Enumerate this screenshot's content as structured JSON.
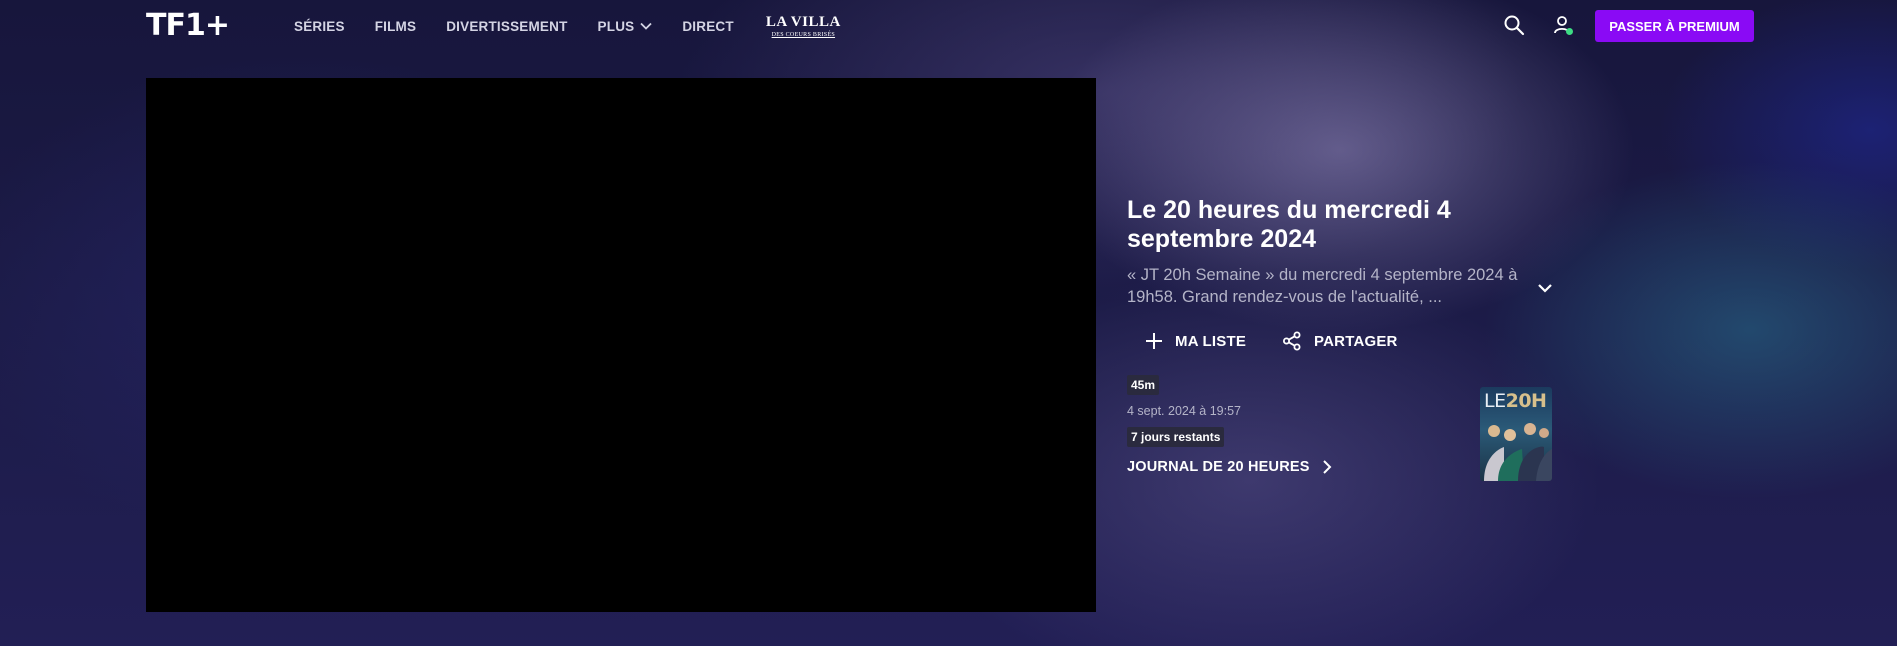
{
  "header": {
    "logo": "TF1+",
    "nav": [
      {
        "label": "SÉRIES"
      },
      {
        "label": "FILMS"
      },
      {
        "label": "DIVERTISSEMENT"
      },
      {
        "label": "PLUS"
      },
      {
        "label": "DIRECT"
      }
    ],
    "villa_title": "LA VILLA",
    "villa_subtitle": "DES COEURS BRISÉS",
    "premium_button": "PASSER À PREMIUM"
  },
  "program": {
    "title": "Le 20 heures du mercredi 4 septembre 2024",
    "description": "« JT 20h Semaine » du mercredi 4 septembre 2024 à 19h58. Grand rendez-vous de l'actualité, ...",
    "actions": {
      "my_list": "MA LISTE",
      "share": "PARTAGER"
    },
    "duration": "45m",
    "broadcast_date": "4 sept. 2024 à 19:57",
    "remaining": "7 jours restants",
    "show_link": "JOURNAL DE 20 HEURES",
    "thumbnail_title_a": "LE",
    "thumbnail_title_b": "20H"
  },
  "colors": {
    "accent": "#8a0af5",
    "online_dot": "#3ddc84"
  },
  "icons": [
    "search-icon",
    "user-icon",
    "chevron-down-icon",
    "plus-icon",
    "share-icon",
    "chevron-right-icon"
  ]
}
